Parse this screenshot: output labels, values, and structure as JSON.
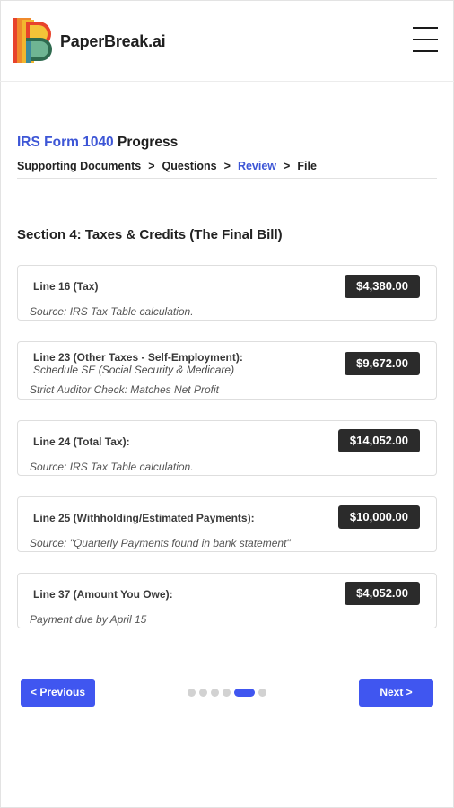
{
  "header": {
    "brand": "PaperBreak.ai",
    "menu_icon": "hamburger-menu-icon"
  },
  "progress": {
    "form_name": "IRS Form 1040",
    "title_suffix": "Progress",
    "steps": [
      "Supporting Documents",
      "Questions",
      "Review",
      "File"
    ],
    "separator": ">",
    "active_step": "Review"
  },
  "section": {
    "title": "Section 4: Taxes & Credits (The Final Bill)",
    "lines": [
      {
        "label": "Line 16 (Tax)",
        "subtitle": "",
        "amount": "$4,380.00",
        "note": "Source: IRS Tax Table calculation."
      },
      {
        "label": "Line 23 (Other Taxes - Self-Employment):",
        "subtitle": "Schedule SE (Social Security & Medicare)",
        "amount": "$9,672.00",
        "note": "Strict Auditor Check: Matches Net Profit"
      },
      {
        "label": "Line 24 (Total Tax):",
        "subtitle": "",
        "amount": "$14,052.00",
        "note": "Source: IRS Tax Table calculation."
      },
      {
        "label": "Line 25 (Withholding/Estimated Payments):",
        "subtitle": "",
        "amount": "$10,000.00",
        "note": "Source: \"Quarterly Payments found in bank statement\""
      },
      {
        "label": "Line 37 (Amount You Owe):",
        "subtitle": "",
        "amount": "$4,052.00",
        "note": "Payment due by April 15"
      }
    ]
  },
  "pagination": {
    "previous_label": "< Previous",
    "next_label": "Next >",
    "total_pages": 6,
    "current_page": 5
  },
  "colors": {
    "accent": "#4056f0",
    "link": "#3d56d6",
    "amount_bg": "#2b2b2b"
  }
}
